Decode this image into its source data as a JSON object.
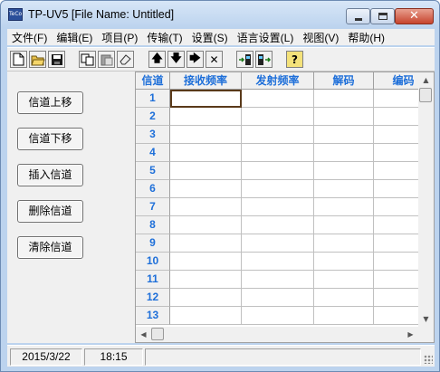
{
  "window": {
    "app_icon_text": "TeCo",
    "title": "TP-UV5 [File Name: Untitled]"
  },
  "menu": [
    "文件(F)",
    "编辑(E)",
    "项目(P)",
    "传输(T)",
    "设置(S)",
    "语言设置(L)",
    "视图(V)",
    "帮助(H)"
  ],
  "toolbar": {
    "buttons": [
      {
        "icon": "new-file-icon"
      },
      {
        "icon": "open-folder-icon"
      },
      {
        "icon": "save-icon"
      },
      {
        "icon": "copy-icon"
      },
      {
        "icon": "paste-icon"
      },
      {
        "icon": "eraser-icon"
      },
      {
        "icon": "arrow-up-icon",
        "glyph": "🡅"
      },
      {
        "icon": "arrow-down-icon",
        "glyph": "🡇"
      },
      {
        "icon": "arrow-right-icon",
        "glyph": "🡆"
      },
      {
        "icon": "delete-x-icon",
        "glyph": "✕"
      },
      {
        "icon": "read-from-radio-icon"
      },
      {
        "icon": "write-to-radio-icon"
      },
      {
        "icon": "help-icon",
        "glyph": "?"
      }
    ]
  },
  "side_buttons": [
    "信道上移",
    "信道下移",
    "插入信道",
    "删除信道",
    "清除信道"
  ],
  "grid": {
    "columns": [
      "信道",
      "接收频率",
      "发射频率",
      "解码",
      "编码"
    ],
    "rows": [
      "1",
      "2",
      "3",
      "4",
      "5",
      "6",
      "7",
      "8",
      "9",
      "10",
      "11",
      "12",
      "13"
    ]
  },
  "status": {
    "date": "2015/3/22",
    "time": "18:15"
  }
}
